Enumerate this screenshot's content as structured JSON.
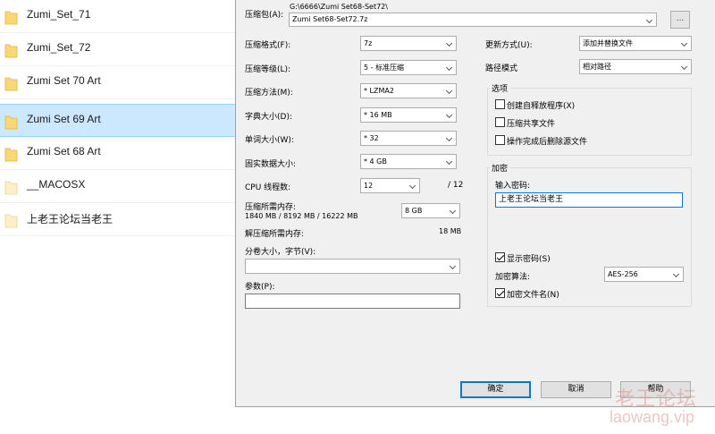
{
  "explorer": {
    "files": [
      {
        "name": "Zumi_Set_71",
        "selected": false
      },
      {
        "name": "Zumi_Set_72",
        "selected": false
      },
      {
        "name": "Zumi Set 70 Art",
        "selected": false
      },
      {
        "name": "Zumi Set 69 Art",
        "selected": true
      },
      {
        "name": "Zumi Set 68 Art",
        "selected": false
      },
      {
        "name": "__MACOSX",
        "selected": false
      },
      {
        "name": "上老王论坛当老王",
        "selected": false
      }
    ]
  },
  "dialog": {
    "archive": {
      "label": "压缩包(A):",
      "path": "G:\\6666\\Zumi Set68-Set72\\",
      "value": "Zumi Set68-Set72.7z",
      "browse_label": "..."
    },
    "format": {
      "label": "压缩格式(F):",
      "value": "7z"
    },
    "level": {
      "label": "压缩等级(L):",
      "value": "5 - 标准压缩"
    },
    "method": {
      "label": "压缩方法(M):",
      "value": "* LZMA2"
    },
    "dict_size": {
      "label": "字典大小(D):",
      "value": "* 16 MB"
    },
    "word_size": {
      "label": "单词大小(W):",
      "value": "* 32"
    },
    "solid_block": {
      "label": "固实数据大小:",
      "value": "* 4 GB"
    },
    "cpu_threads": {
      "label": "CPU 线程数:",
      "value": "12",
      "max": "/ 12"
    },
    "compress_memory": {
      "label": "压缩所需内存:",
      "detail": "1840 MB / 8192 MB / 16222 MB",
      "value": "8 GB"
    },
    "decompress_memory": {
      "label": "解压缩所需内存:",
      "value": "18 MB"
    },
    "split_volumes": {
      "label": "分卷大小，字节(V):",
      "value": ""
    },
    "parameters": {
      "label": "参数(P):",
      "value": ""
    },
    "update_mode": {
      "label": "更新方式(U):",
      "value": "添加并替换文件"
    },
    "path_mode": {
      "label": "路径模式",
      "value": "相对路径"
    },
    "options": {
      "title": "选项",
      "items": [
        {
          "label": "创建自释放程序(X)",
          "checked": false
        },
        {
          "label": "压缩共享文件",
          "checked": false
        },
        {
          "label": "操作完成后删除源文件",
          "checked": false
        }
      ]
    },
    "encryption": {
      "title": "加密",
      "password_label": "输入密码:",
      "password_value": "上老王论坛当老王",
      "show_password": {
        "label": "显示密码(S)",
        "checked": true
      },
      "method_label": "加密算法:",
      "method_value": "AES-256",
      "encrypt_names": {
        "label": "加密文件名(N)",
        "checked": true
      }
    },
    "buttons": {
      "ok": "确定",
      "cancel": "取消",
      "help": "帮助"
    }
  },
  "watermark": {
    "cn": "老王论坛",
    "en": "laowang.vip"
  }
}
